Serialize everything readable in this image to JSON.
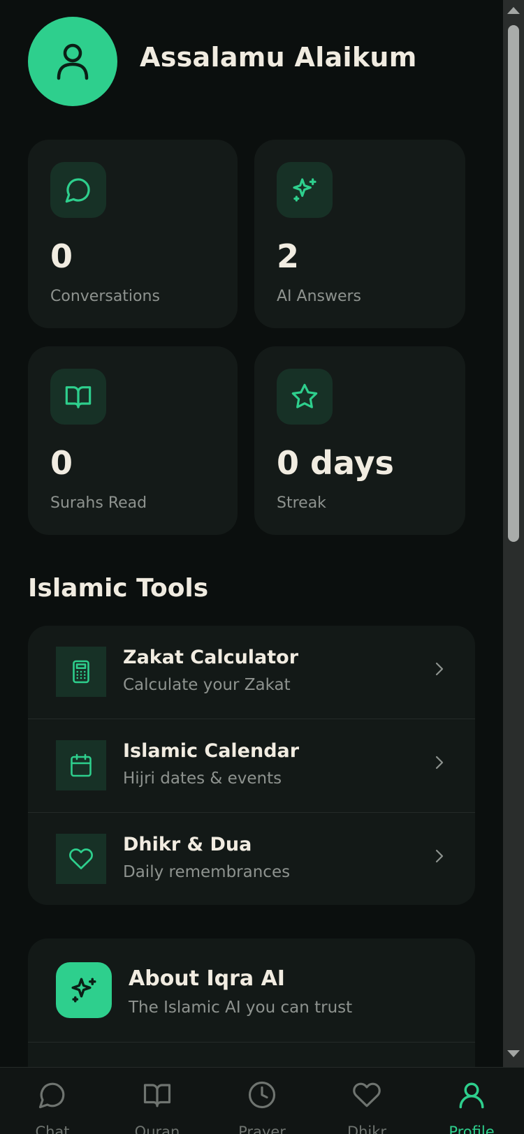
{
  "header": {
    "greeting": "Assalamu Alaikum",
    "avatar_icon": "user-icon"
  },
  "stats": [
    {
      "value": "0",
      "label": "Conversations",
      "icon": "chat-bubble-icon"
    },
    {
      "value": "2",
      "label": "AI Answers",
      "icon": "sparkles-icon"
    },
    {
      "value": "0",
      "label": "Surahs Read",
      "icon": "book-open-icon"
    },
    {
      "value": "0 days",
      "label": "Streak",
      "icon": "star-icon"
    }
  ],
  "tools_section": {
    "title": "Islamic Tools",
    "items": [
      {
        "title": "Zakat Calculator",
        "subtitle": "Calculate your Zakat",
        "icon": "calculator-icon"
      },
      {
        "title": "Islamic Calendar",
        "subtitle": "Hijri dates & events",
        "icon": "calendar-icon"
      },
      {
        "title": "Dhikr & Dua",
        "subtitle": "Daily remembrances",
        "icon": "heart-icon"
      }
    ]
  },
  "about": {
    "title": "About Iqra AI",
    "subtitle": "The Islamic AI you can trust",
    "icon": "sparkles-icon"
  },
  "bottom_nav": {
    "active": "Profile",
    "items": [
      {
        "label": "Chat",
        "icon": "chat-bubble-icon"
      },
      {
        "label": "Quran",
        "icon": "book-open-icon"
      },
      {
        "label": "Prayer",
        "icon": "clock-icon"
      },
      {
        "label": "Dhikr",
        "icon": "heart-icon"
      },
      {
        "label": "Profile",
        "icon": "user-icon"
      }
    ]
  },
  "colors": {
    "accent": "#2ecf8d",
    "background": "#0b0f0e",
    "card": "#141a18",
    "icon_tile": "#173126",
    "muted_text": "#8e938f"
  }
}
